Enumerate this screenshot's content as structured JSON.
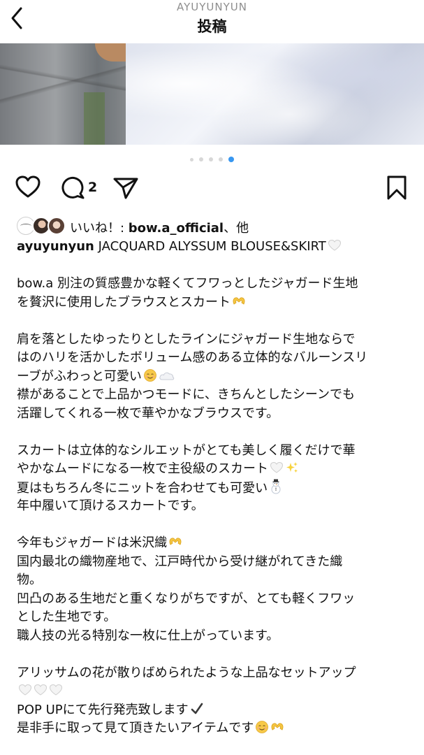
{
  "header": {
    "username": "AYUYUNYUN",
    "title": "投稿"
  },
  "carousel": {
    "count": 5,
    "active_index": 4
  },
  "actions": {
    "comment_count": "2"
  },
  "likes": {
    "prefix": "いいね！: ",
    "user": "bow.a_official",
    "suffix": "、他"
  },
  "caption": {
    "username": "ayuyunyun",
    "lines": [
      {
        "text": " JACQUARD ALYSSUM BLOUSE&SKIRT",
        "emoji": [
          "white-heart"
        ]
      },
      {
        "text": "",
        "blank": true
      },
      {
        "text": "bow.a 別注の質感豊かな軽くてフワっとしたジャガード生地",
        "emoji": []
      },
      {
        "text": "を贅沢に使用したブラウスとスカート",
        "emoji": [
          "heart-hands"
        ]
      },
      {
        "text": "",
        "blank": true
      },
      {
        "text": "肩を落としたゆったりとしたラインにジャガード生地ならで",
        "emoji": []
      },
      {
        "text": "はのハリを活かしたボリューム感のある立体的なバルーンスリ",
        "emoji": []
      },
      {
        "text": "ーブがふわっと可愛い",
        "emoji": [
          "relieved-face",
          "cloud"
        ]
      },
      {
        "text": "襟があることで上品かつモードに、きちんとしたシーンでも",
        "emoji": []
      },
      {
        "text": "活躍してくれる一枚で華やかなブラウスです。",
        "emoji": []
      },
      {
        "text": "",
        "blank": true
      },
      {
        "text": "スカートは立体的なシルエットがとても美しく履くだけで華",
        "emoji": []
      },
      {
        "text": "やかなムードになる一枚で主役級のスカート",
        "emoji": [
          "white-heart",
          "sparkles"
        ]
      },
      {
        "text": "夏はもちろん冬にニットを合わせても可愛い",
        "emoji": [
          "snowman"
        ]
      },
      {
        "text": "年中履いて頂けるスカートです。",
        "emoji": []
      },
      {
        "text": "",
        "blank": true
      },
      {
        "text": "今年もジャガードは米沢織",
        "emoji": [
          "heart-hands"
        ]
      },
      {
        "text": "国内最北の織物産地で、江戸時代から受け継がれてきた織",
        "emoji": []
      },
      {
        "text": "物。",
        "emoji": []
      },
      {
        "text": "凹凸のある生地だと重くなりがちですが、とても軽くフワッ",
        "emoji": []
      },
      {
        "text": "とした生地です。",
        "emoji": []
      },
      {
        "text": "職人技の光る特別な一枚に仕上がっています。",
        "emoji": []
      },
      {
        "text": "",
        "blank": true
      },
      {
        "text": "アリッサムの花が散りばめられたような上品なセットアップ",
        "emoji": []
      },
      {
        "text": "",
        "emoji": [
          "white-heart",
          "white-heart",
          "white-heart"
        ]
      },
      {
        "text": "POP UPにて先行発売致します",
        "emoji": [
          "check-mark"
        ]
      },
      {
        "text": "是非手に取って見て頂きたいアイテムです",
        "emoji": [
          "relieved-face",
          "heart-hands"
        ]
      }
    ]
  },
  "icons": {
    "back": "chevron-left-icon",
    "like": "heart-icon",
    "comment": "comment-icon",
    "share": "paper-plane-icon",
    "save": "bookmark-icon"
  },
  "colors": {
    "carousel_active": "#3897f0",
    "header_username": "#8e8e8e"
  }
}
